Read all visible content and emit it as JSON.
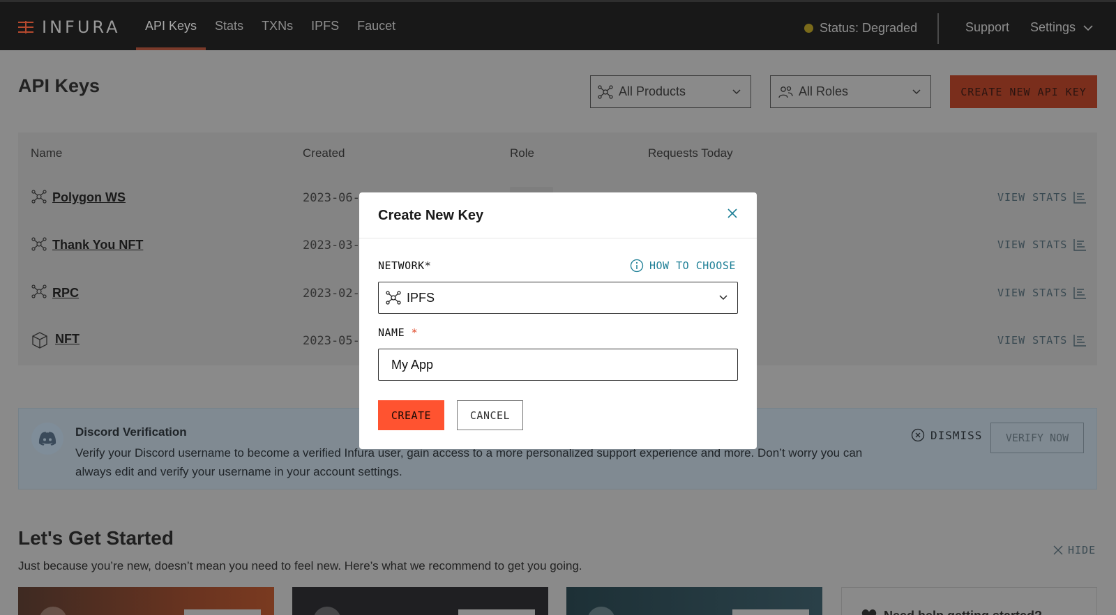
{
  "brand": {
    "name": "INFURA"
  },
  "nav": {
    "links": [
      {
        "label": "API Keys"
      },
      {
        "label": "Stats"
      },
      {
        "label": "TXNs"
      },
      {
        "label": "IPFS"
      },
      {
        "label": "Faucet"
      }
    ],
    "status": "Status: Degraded",
    "support": "Support",
    "settings": "Settings"
  },
  "page": {
    "title": "API Keys",
    "filters": {
      "products": "All Products",
      "roles": "All Roles"
    },
    "create_button": "CREATE NEW API KEY"
  },
  "table": {
    "headers": {
      "name": "Name",
      "created": "Created",
      "role": "Role",
      "requests": "Requests Today"
    },
    "rows": [
      {
        "name": "Polygon WS",
        "created": "2023-06-",
        "action": "VIEW STATS",
        "icon": "network-icon"
      },
      {
        "name": "Thank You NFT",
        "created": "2023-03-",
        "action": "VIEW STATS",
        "icon": "network-icon"
      },
      {
        "name": "RPC",
        "created": "2023-02-",
        "action": "VIEW STATS",
        "icon": "network-icon"
      },
      {
        "name": "NFT",
        "created": "2023-05-",
        "action": "VIEW STATS",
        "icon": "cube-icon"
      }
    ]
  },
  "discord": {
    "title": "Discord Verification",
    "text": "Verify your Discord username to become a verified Infura user, gain access to a more personalized support experience and more. Don’t worry you can always edit and verify your username in your account settings.",
    "dismiss": "DISMISS",
    "verify": "VERIFY NOW"
  },
  "getting_started": {
    "title": "Let's Get Started",
    "subtitle": "Just because you’re new, doesn’t mean you need to feel new. Here’s what we recommend to get you going.",
    "hide": "HIDE",
    "card4_text": "Need help getting started?"
  },
  "modal": {
    "title": "Create New Key",
    "network_label": "NETWORK*",
    "how_to_choose": "HOW TO CHOOSE",
    "network_value": "IPFS",
    "name_label": "NAME",
    "name_required": "*",
    "name_value": "My App",
    "create": "CREATE",
    "cancel": "CANCEL"
  },
  "colors": {
    "accent": "#ff5330",
    "link": "#1e7f96",
    "nav_bg": "#181818",
    "overlay_bg": "#8a8a8a"
  }
}
